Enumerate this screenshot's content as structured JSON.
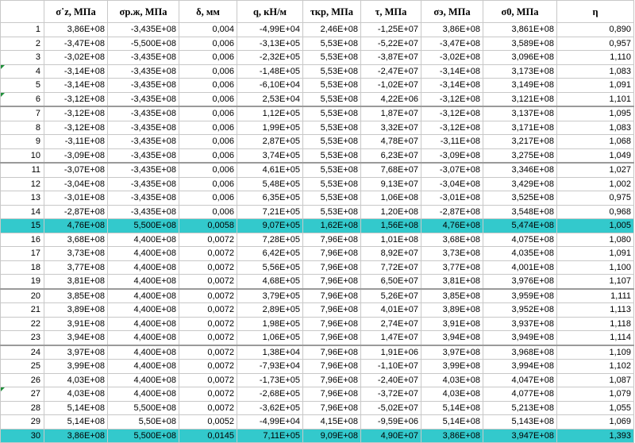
{
  "headers": [
    "",
    "σ˙z, МПа",
    "σр.ж, МПа",
    "δ, мм",
    "q, кН/м",
    "τкр, МПа",
    "τ, МПа",
    "σэ, МПа",
    "σ0, МПа",
    "η"
  ],
  "rows": [
    [
      "1",
      "3,86E+08",
      "-3,435E+08",
      "0,004",
      "-4,99E+04",
      "2,46E+08",
      "-1,25E+07",
      "3,86E+08",
      "3,861E+08",
      "0,890"
    ],
    [
      "2",
      "-3,47E+08",
      "-5,500E+08",
      "0,006",
      "-3,13E+05",
      "5,53E+08",
      "-5,22E+07",
      "-3,47E+08",
      "3,589E+08",
      "0,957"
    ],
    [
      "3",
      "-3,02E+08",
      "-3,435E+08",
      "0,006",
      "-2,32E+05",
      "5,53E+08",
      "-3,87E+07",
      "-3,02E+08",
      "3,096E+08",
      "1,110"
    ],
    [
      "4",
      "-3,14E+08",
      "-3,435E+08",
      "0,006",
      "-1,48E+05",
      "5,53E+08",
      "-2,47E+07",
      "-3,14E+08",
      "3,173E+08",
      "1,083"
    ],
    [
      "5",
      "-3,14E+08",
      "-3,435E+08",
      "0,006",
      "-6,10E+04",
      "5,53E+08",
      "-1,02E+07",
      "-3,14E+08",
      "3,149E+08",
      "1,091"
    ],
    [
      "6",
      "-3,12E+08",
      "-3,435E+08",
      "0,006",
      "2,53E+04",
      "5,53E+08",
      "4,22E+06",
      "-3,12E+08",
      "3,121E+08",
      "1,101"
    ],
    [
      "7",
      "-3,12E+08",
      "-3,435E+08",
      "0,006",
      "1,12E+05",
      "5,53E+08",
      "1,87E+07",
      "-3,12E+08",
      "3,137E+08",
      "1,095"
    ],
    [
      "8",
      "-3,12E+08",
      "-3,435E+08",
      "0,006",
      "1,99E+05",
      "5,53E+08",
      "3,32E+07",
      "-3,12E+08",
      "3,171E+08",
      "1,083"
    ],
    [
      "9",
      "-3,11E+08",
      "-3,435E+08",
      "0,006",
      "2,87E+05",
      "5,53E+08",
      "4,78E+07",
      "-3,11E+08",
      "3,217E+08",
      "1,068"
    ],
    [
      "10",
      "-3,09E+08",
      "-3,435E+08",
      "0,006",
      "3,74E+05",
      "5,53E+08",
      "6,23E+07",
      "-3,09E+08",
      "3,275E+08",
      "1,049"
    ],
    [
      "11",
      "-3,07E+08",
      "-3,435E+08",
      "0,006",
      "4,61E+05",
      "5,53E+08",
      "7,68E+07",
      "-3,07E+08",
      "3,346E+08",
      "1,027"
    ],
    [
      "12",
      "-3,04E+08",
      "-3,435E+08",
      "0,006",
      "5,48E+05",
      "5,53E+08",
      "9,13E+07",
      "-3,04E+08",
      "3,429E+08",
      "1,002"
    ],
    [
      "13",
      "-3,01E+08",
      "-3,435E+08",
      "0,006",
      "6,35E+05",
      "5,53E+08",
      "1,06E+08",
      "-3,01E+08",
      "3,525E+08",
      "0,975"
    ],
    [
      "14",
      "-2,87E+08",
      "-3,435E+08",
      "0,006",
      "7,21E+05",
      "5,53E+08",
      "1,20E+08",
      "-2,87E+08",
      "3,548E+08",
      "0,968"
    ],
    [
      "15",
      "4,76E+08",
      "5,500E+08",
      "0,0058",
      "9,07E+05",
      "1,62E+08",
      "1,56E+08",
      "4,76E+08",
      "5,474E+08",
      "1,005"
    ],
    [
      "16",
      "3,68E+08",
      "4,400E+08",
      "0,0072",
      "7,28E+05",
      "7,96E+08",
      "1,01E+08",
      "3,68E+08",
      "4,075E+08",
      "1,080"
    ],
    [
      "17",
      "3,73E+08",
      "4,400E+08",
      "0,0072",
      "6,42E+05",
      "7,96E+08",
      "8,92E+07",
      "3,73E+08",
      "4,035E+08",
      "1,091"
    ],
    [
      "18",
      "3,77E+08",
      "4,400E+08",
      "0,0072",
      "5,56E+05",
      "7,96E+08",
      "7,72E+07",
      "3,77E+08",
      "4,001E+08",
      "1,100"
    ],
    [
      "19",
      "3,81E+08",
      "4,400E+08",
      "0,0072",
      "4,68E+05",
      "7,96E+08",
      "6,50E+07",
      "3,81E+08",
      "3,976E+08",
      "1,107"
    ],
    [
      "20",
      "3,85E+08",
      "4,400E+08",
      "0,0072",
      "3,79E+05",
      "7,96E+08",
      "5,26E+07",
      "3,85E+08",
      "3,959E+08",
      "1,111"
    ],
    [
      "21",
      "3,89E+08",
      "4,400E+08",
      "0,0072",
      "2,89E+05",
      "7,96E+08",
      "4,01E+07",
      "3,89E+08",
      "3,952E+08",
      "1,113"
    ],
    [
      "22",
      "3,91E+08",
      "4,400E+08",
      "0,0072",
      "1,98E+05",
      "7,96E+08",
      "2,74E+07",
      "3,91E+08",
      "3,937E+08",
      "1,118"
    ],
    [
      "23",
      "3,94E+08",
      "4,400E+08",
      "0,0072",
      "1,06E+05",
      "7,96E+08",
      "1,47E+07",
      "3,94E+08",
      "3,949E+08",
      "1,114"
    ],
    [
      "24",
      "3,97E+08",
      "4,400E+08",
      "0,0072",
      "1,38E+04",
      "7,96E+08",
      "1,91E+06",
      "3,97E+08",
      "3,968E+08",
      "1,109"
    ],
    [
      "25",
      "3,99E+08",
      "4,400E+08",
      "0,0072",
      "-7,93E+04",
      "7,96E+08",
      "-1,10E+07",
      "3,99E+08",
      "3,994E+08",
      "1,102"
    ],
    [
      "26",
      "4,03E+08",
      "4,400E+08",
      "0,0072",
      "-1,73E+05",
      "7,96E+08",
      "-2,40E+07",
      "4,03E+08",
      "4,047E+08",
      "1,087"
    ],
    [
      "27",
      "4,03E+08",
      "4,400E+08",
      "0,0072",
      "-2,68E+05",
      "7,96E+08",
      "-3,72E+07",
      "4,03E+08",
      "4,077E+08",
      "1,079"
    ],
    [
      "28",
      "5,14E+08",
      "5,500E+08",
      "0,0072",
      "-3,62E+05",
      "7,96E+08",
      "-5,02E+07",
      "5,14E+08",
      "5,213E+08",
      "1,055"
    ],
    [
      "29",
      "5,14E+08",
      "5,50E+08",
      "0,0052",
      "-4,99E+04",
      "4,15E+08",
      "-9,59E+06",
      "5,14E+08",
      "5,143E+08",
      "1,069"
    ],
    [
      "30",
      "3,86E+08",
      "5,500E+08",
      "0,0145",
      "7,11E+05",
      "9,09E+08",
      "4,90E+07",
      "3,86E+08",
      "3,947E+08",
      "1,393"
    ]
  ],
  "highlighted_rows": [
    "15",
    "30"
  ],
  "flagged_rows": [
    "4",
    "6",
    "27"
  ],
  "colors": {
    "highlight": "#33c9cc",
    "flag": "#1f8f3a",
    "grid": "#c8c8c8"
  }
}
